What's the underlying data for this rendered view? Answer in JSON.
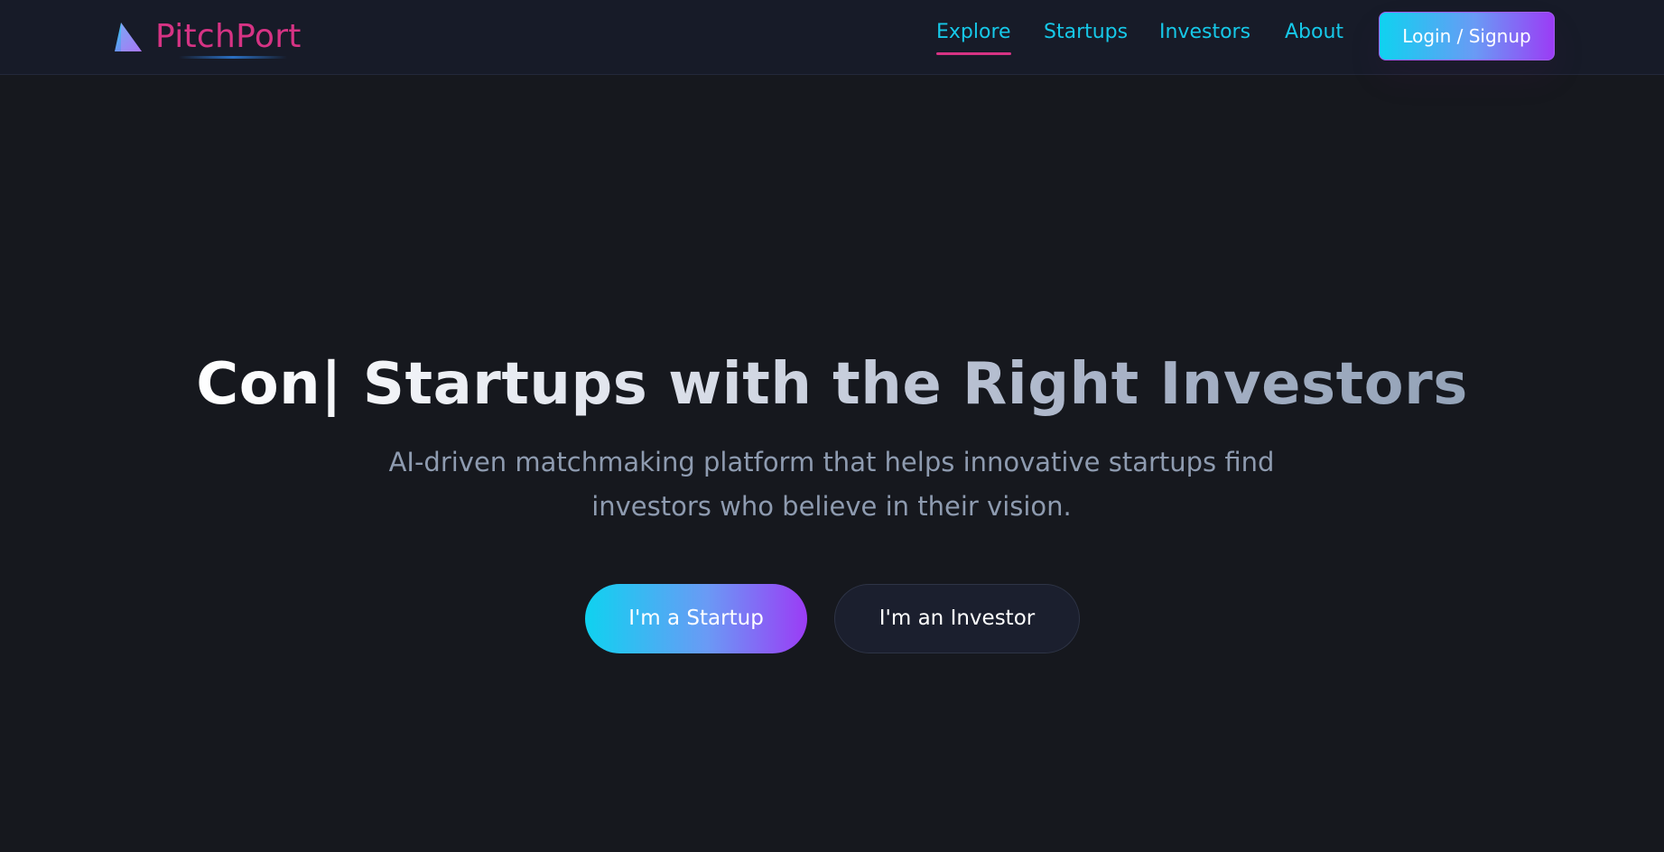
{
  "brand": {
    "name": "PitchPort",
    "icon": "triangle-logo-icon",
    "color": "#d63384"
  },
  "nav": {
    "items": [
      {
        "label": "Explore",
        "active": true
      },
      {
        "label": "Startups",
        "active": false
      },
      {
        "label": "Investors",
        "active": false
      },
      {
        "label": "About",
        "active": false
      }
    ],
    "login_label": "Login / Signup",
    "link_color": "#16c8e8",
    "active_underline_color": "#d63384"
  },
  "hero": {
    "title": "Con| Startups with the Right Investors",
    "subtitle": "AI-driven matchmaking platform that helps innovative startups find investors who believe in their vision.",
    "startup_button": "I'm a Startup",
    "investor_button": "I'm an Investor"
  },
  "theme": {
    "background": "#16181e",
    "navbar_background": "#171b28",
    "gradient_start": "#0fd2f0",
    "gradient_end": "#9b3cf5"
  }
}
